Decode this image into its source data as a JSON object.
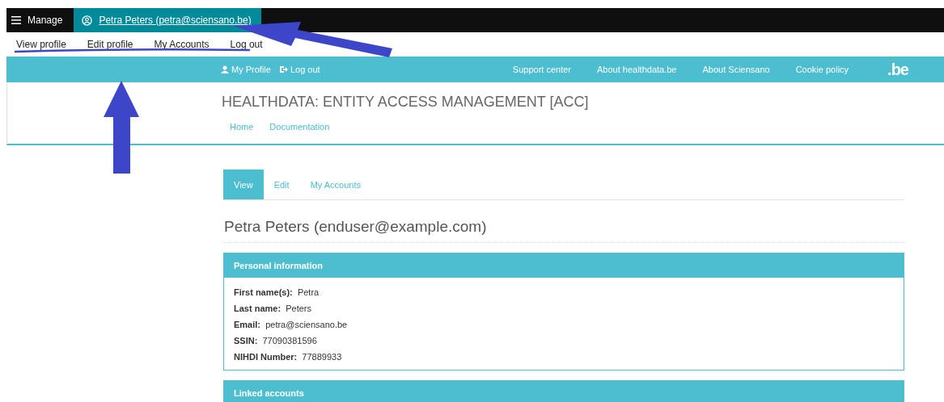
{
  "toolbar": {
    "manage": "Manage",
    "user": "Petra Peters (petra@sciensano.be)"
  },
  "tray": [
    {
      "label": "View profile"
    },
    {
      "label": "Edit profile"
    },
    {
      "label": "My Accounts"
    },
    {
      "label": "Log out"
    }
  ],
  "topbar": {
    "left": [
      {
        "kind": "profile",
        "label": "My Profile"
      },
      {
        "kind": "logout",
        "label": "Log out"
      }
    ],
    "right": [
      "Support center",
      "About healthdata.be",
      "About Sciensano",
      "Cookie policy"
    ],
    "logo": ".be"
  },
  "site_title": "HEALTHDATA: ENTITY ACCESS MANAGEMENT [ACC]",
  "nav": [
    "Home",
    "Documentation"
  ],
  "tabs": [
    {
      "label": "View",
      "selected": true
    },
    {
      "label": "Edit",
      "selected": false
    },
    {
      "label": "My Accounts",
      "selected": false
    }
  ],
  "page_title": "Petra Peters (enduser@example.com)",
  "panels": [
    {
      "title": "Personal information",
      "fields": [
        {
          "label": "First name(s):",
          "value": "Petra"
        },
        {
          "label": "Last name:",
          "value": "Peters"
        },
        {
          "label": "Email:",
          "value": "petra@sciensano.be"
        },
        {
          "label": "SSIN:",
          "value": "77090381596"
        },
        {
          "label": "NIHDI Number:",
          "value": "77889933"
        }
      ]
    },
    {
      "title": "Linked accounts"
    }
  ]
}
